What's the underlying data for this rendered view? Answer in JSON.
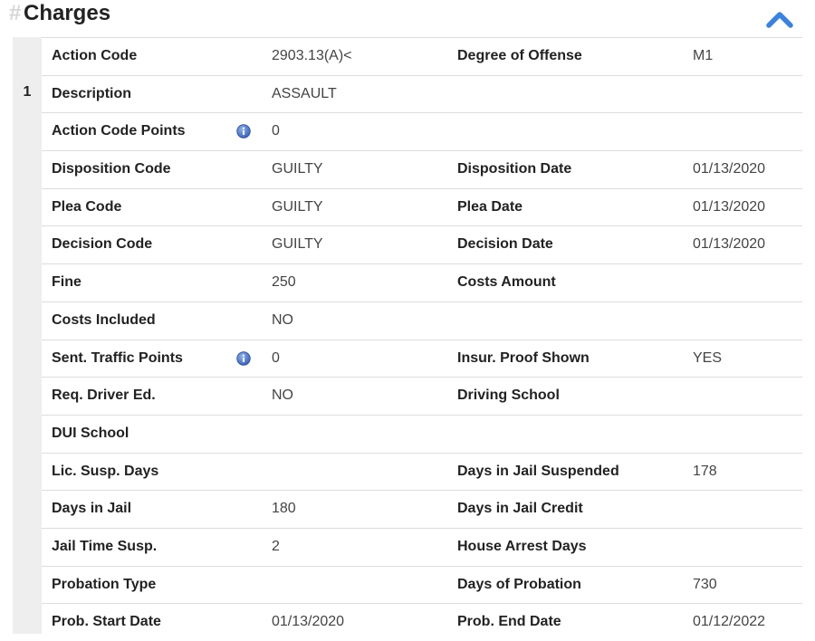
{
  "section": {
    "hash": "#",
    "title": "Charges"
  },
  "charge": {
    "number": "1",
    "rows": [
      {
        "l1": "Action Code",
        "v1": "2903.13(A)<",
        "l2": "Degree of Offense",
        "v2": "M1",
        "info": false
      },
      {
        "l1": "Description",
        "v1": "ASSAULT",
        "l2": "",
        "v2": "",
        "info": false
      },
      {
        "l1": "Action Code Points",
        "v1": "0",
        "l2": "",
        "v2": "",
        "info": true
      },
      {
        "l1": "Disposition Code",
        "v1": "GUILTY",
        "l2": "Disposition Date",
        "v2": "01/13/2020",
        "info": false
      },
      {
        "l1": "Plea Code",
        "v1": "GUILTY",
        "l2": "Plea Date",
        "v2": "01/13/2020",
        "info": false
      },
      {
        "l1": "Decision Code",
        "v1": "GUILTY",
        "l2": "Decision Date",
        "v2": "01/13/2020",
        "info": false
      },
      {
        "l1": "Fine",
        "v1": "250",
        "l2": "Costs Amount",
        "v2": "",
        "info": false
      },
      {
        "l1": "Costs Included",
        "v1": "NO",
        "l2": "",
        "v2": "",
        "info": false
      },
      {
        "l1": "Sent. Traffic Points",
        "v1": "0",
        "l2": "Insur. Proof Shown",
        "v2": "YES",
        "info": true
      },
      {
        "l1": "Req. Driver Ed.",
        "v1": "NO",
        "l2": "Driving School",
        "v2": "",
        "info": false
      },
      {
        "l1": "DUI School",
        "v1": "",
        "l2": "",
        "v2": "",
        "info": false
      },
      {
        "l1": "Lic. Susp. Days",
        "v1": "",
        "l2": "Days in Jail Suspended",
        "v2": "178",
        "info": false
      },
      {
        "l1": "Days in Jail",
        "v1": "180",
        "l2": "Days in Jail Credit",
        "v2": "",
        "info": false
      },
      {
        "l1": "Jail Time Susp.",
        "v1": "2",
        "l2": "House Arrest Days",
        "v2": "",
        "info": false
      },
      {
        "l1": "Probation Type",
        "v1": "",
        "l2": "Days of Probation",
        "v2": "730",
        "info": false
      },
      {
        "l1": "Prob. Start Date",
        "v1": "01/13/2020",
        "l2": "Prob. End Date",
        "v2": "01/12/2022",
        "info": false
      }
    ]
  },
  "icons": {
    "collapse": "chevron-up-icon",
    "info": "info-icon"
  },
  "colors": {
    "accent": "#3b82e0",
    "info_icon": "#4a74c9"
  }
}
